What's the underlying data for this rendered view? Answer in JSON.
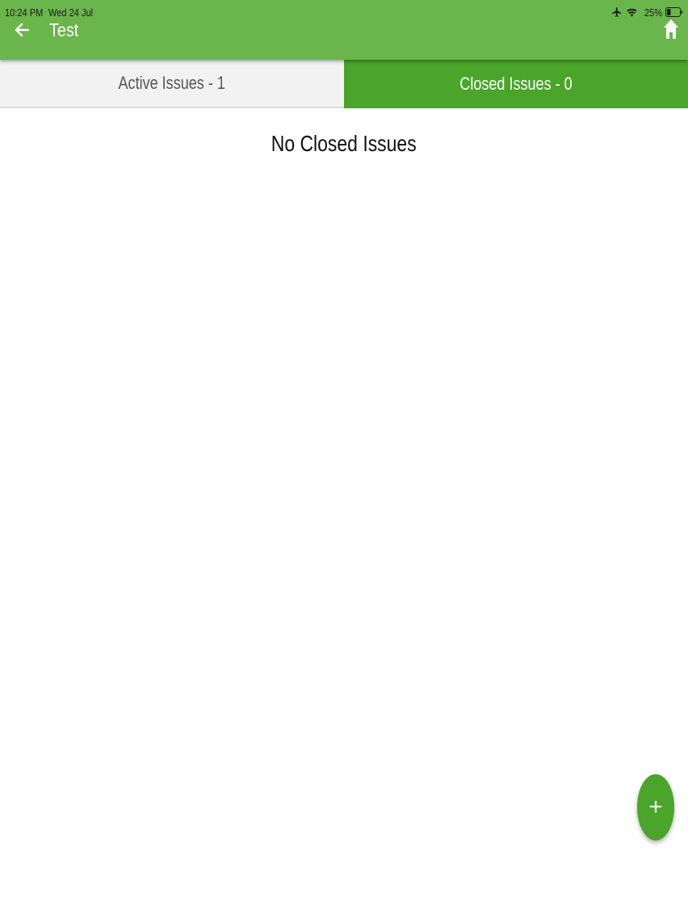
{
  "status_bar": {
    "time": "10:24 PM",
    "date": "Wed 24 Jul",
    "battery": "25%",
    "icons": [
      "airplane-icon",
      "wifi-icon",
      "battery-icon"
    ]
  },
  "header": {
    "title": "Test",
    "back_icon": "arrow-left-icon",
    "home_icon": "home-icon"
  },
  "tabs": [
    {
      "label": "Active Issues - 1",
      "selected": false
    },
    {
      "label": "Closed Issues - 0",
      "selected": true
    }
  ],
  "main": {
    "empty_message": "No Closed Issues"
  },
  "fab": {
    "label": "+",
    "icon": "plus-icon"
  },
  "colors": {
    "header": "#6ab54c",
    "selected_tab": "#4aa52a",
    "unselected_tab": "#f2f2f2",
    "fab": "#4aa52a"
  }
}
